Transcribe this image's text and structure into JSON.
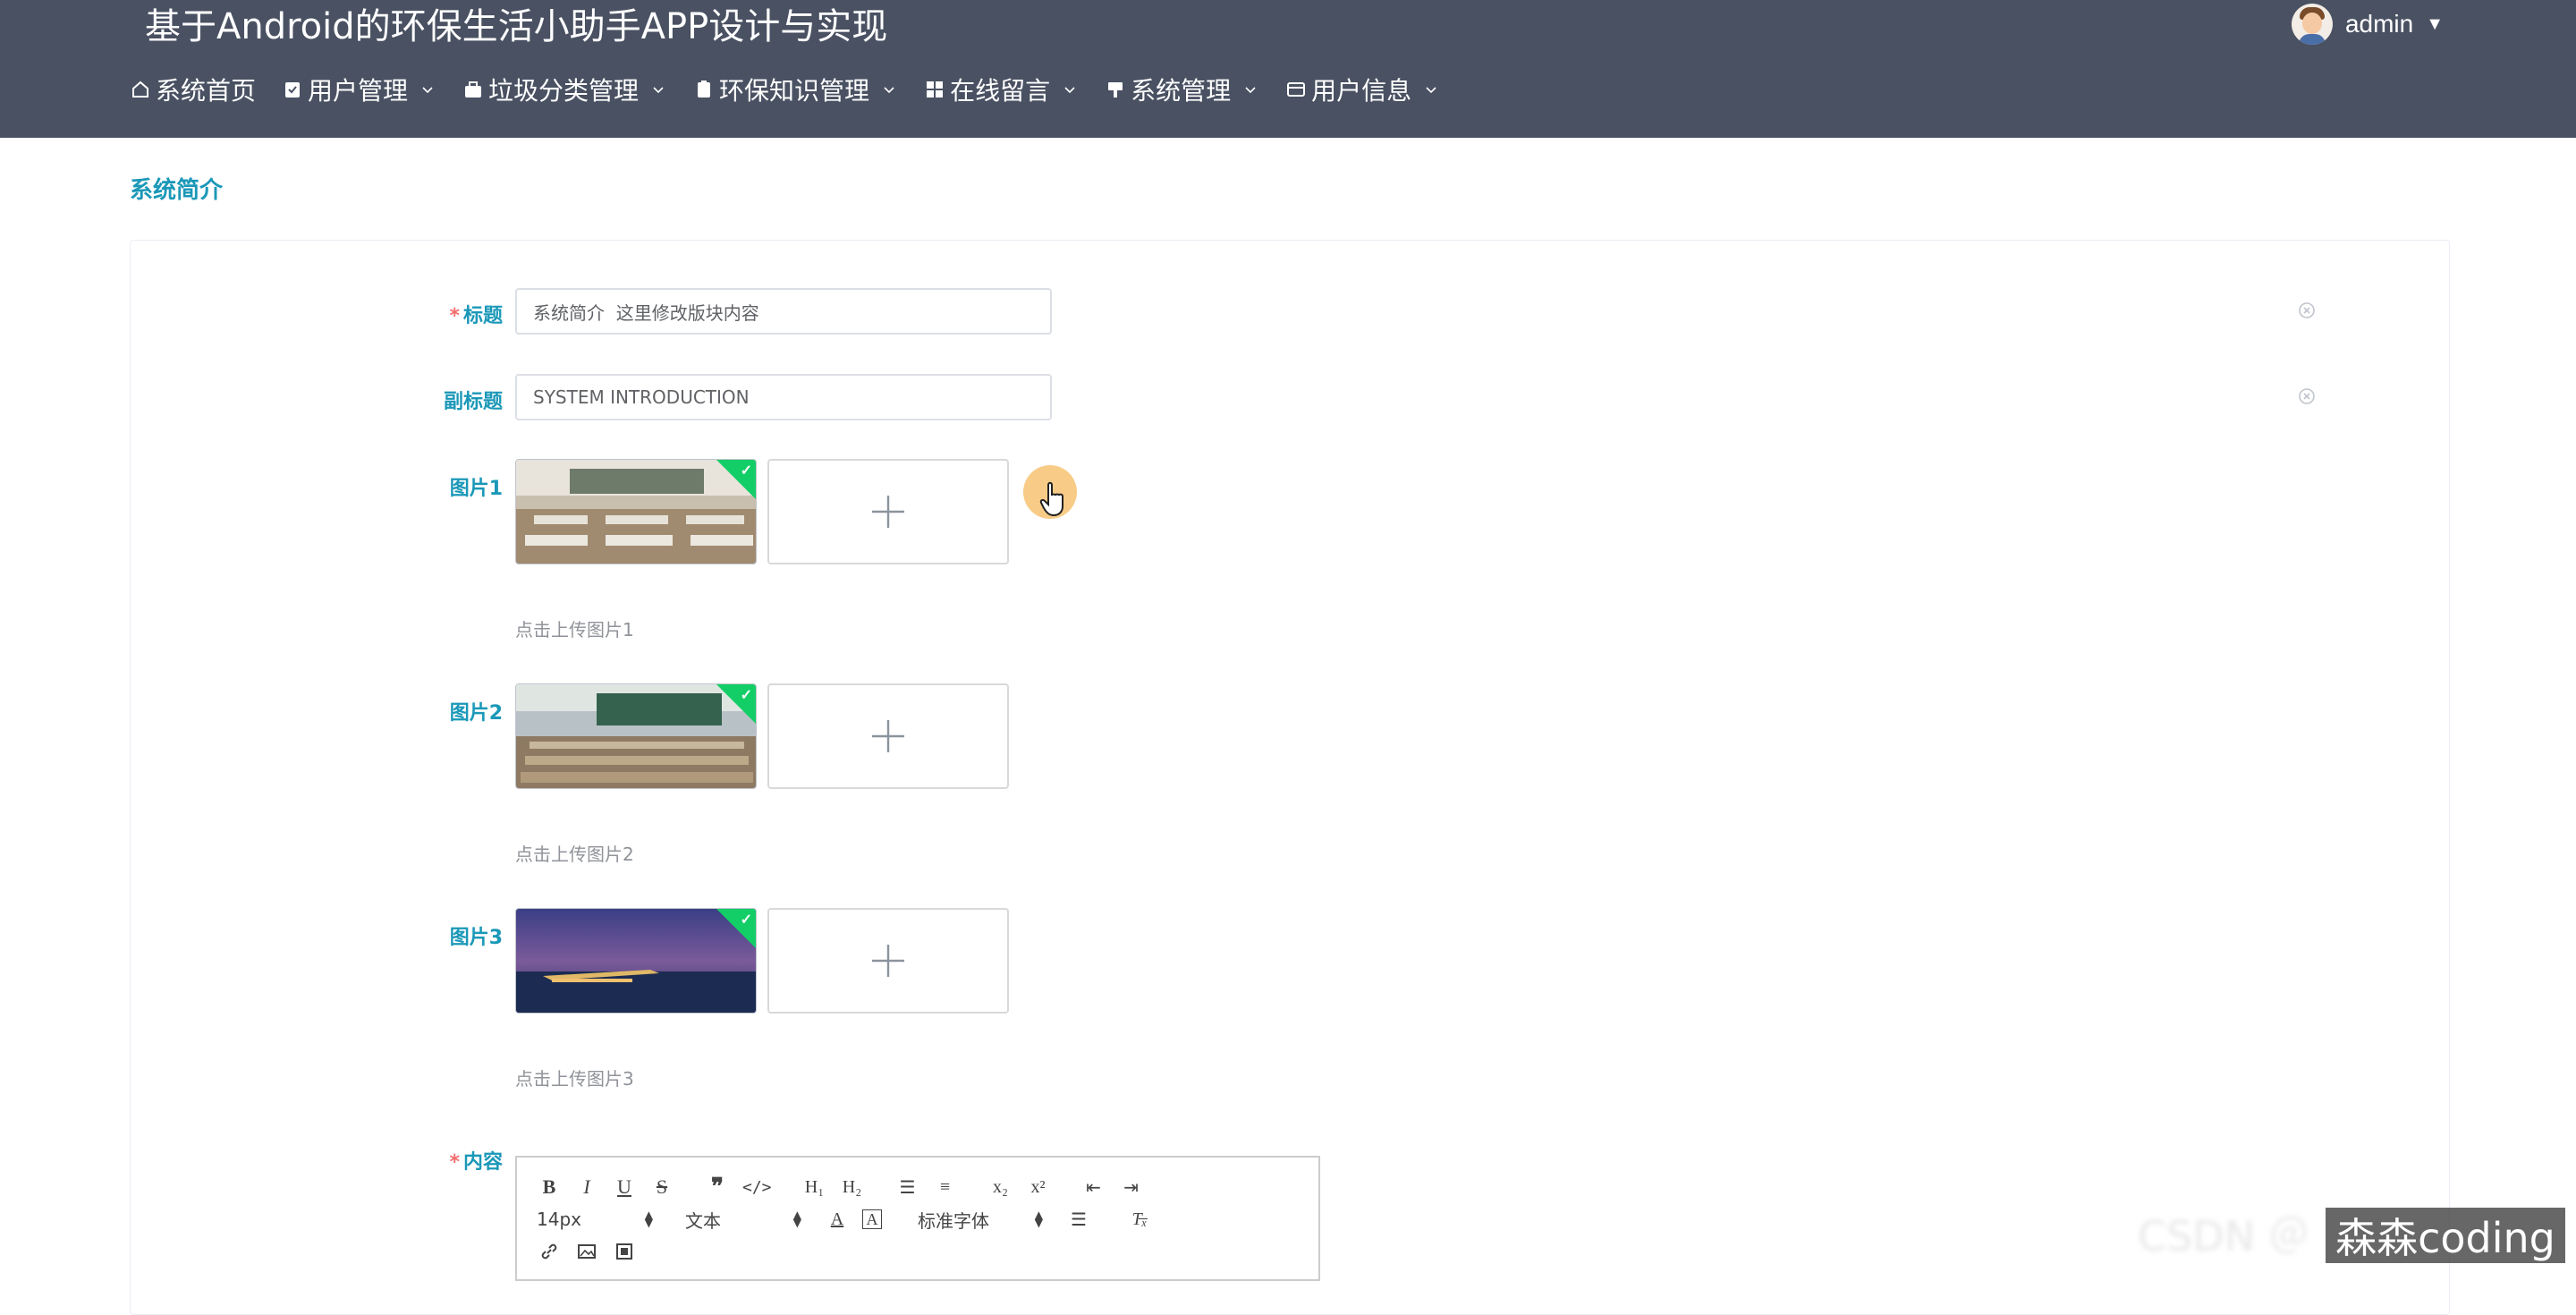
{
  "header": {
    "app_title": "基于Android的环保生活小助手APP设计与实现",
    "username": "admin",
    "nav": [
      {
        "label": "系统首页",
        "icon": "home-icon",
        "dropdown": false
      },
      {
        "label": "用户管理",
        "icon": "clipboard-check-icon",
        "dropdown": true
      },
      {
        "label": "垃圾分类管理",
        "icon": "briefcase-icon",
        "dropdown": true
      },
      {
        "label": "环保知识管理",
        "icon": "clipboard-icon",
        "dropdown": true
      },
      {
        "label": "在线留言",
        "icon": "grid-icon",
        "dropdown": true
      },
      {
        "label": "系统管理",
        "icon": "brush-icon",
        "dropdown": true
      },
      {
        "label": "用户信息",
        "icon": "id-card-icon",
        "dropdown": true
      }
    ]
  },
  "section_title": "系统简介",
  "form": {
    "title": {
      "label": "标题",
      "required": "*",
      "value": "系统简介  这里修改版块内容"
    },
    "subtitle": {
      "label": "副标题",
      "value": "SYSTEM INTRODUCTION"
    },
    "pictures": [
      {
        "label": "图片1",
        "tip": "点击上传图片1"
      },
      {
        "label": "图片2",
        "tip": "点击上传图片2"
      },
      {
        "label": "图片3",
        "tip": "点击上传图片3"
      }
    ],
    "content": {
      "label": "内容",
      "required": "*"
    }
  },
  "editor": {
    "font_size": "14px",
    "block_type": "文本",
    "font_family": "标准字体"
  },
  "watermark": "森森coding",
  "colors": {
    "header_bg": "#495162",
    "accent": "#1b98b8",
    "required": "#f56c6c",
    "success_badge": "#13ce66"
  }
}
